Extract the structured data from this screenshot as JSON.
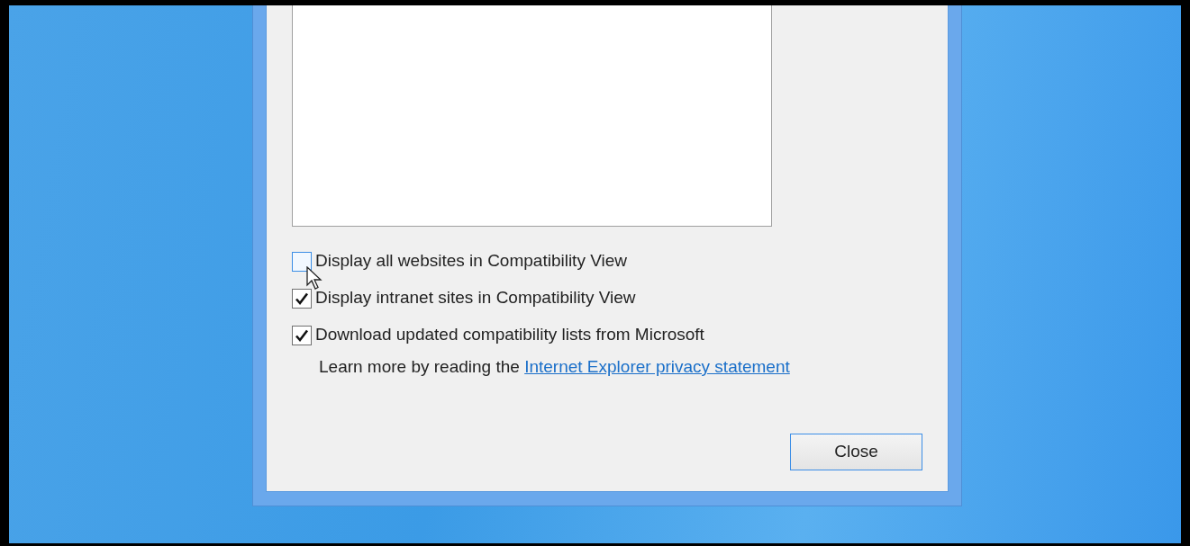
{
  "dialog": {
    "options": [
      {
        "label": "Display all websites in Compatibility View",
        "checked": false,
        "focused": true
      },
      {
        "label": "Display intranet sites in Compatibility View",
        "checked": true,
        "focused": false
      },
      {
        "label": "Download updated compatibility lists from Microsoft",
        "checked": true,
        "focused": false
      }
    ],
    "privacy_note": {
      "text": "Learn more by reading the",
      "link": "Internet Explorer privacy statement"
    },
    "buttons": [
      {
        "label": "Close"
      }
    ]
  }
}
